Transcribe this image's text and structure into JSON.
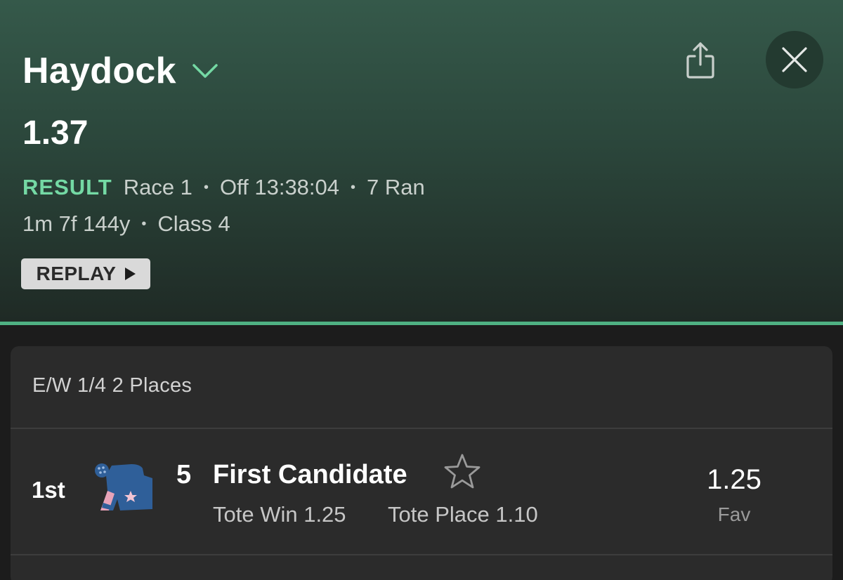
{
  "header": {
    "venue": "Haydock",
    "race_time": "1.37",
    "status": "RESULT",
    "race_number": "Race 1",
    "off_time": "Off 13:38:04",
    "runners": "7 Ran",
    "distance": "1m 7f 144y",
    "race_class": "Class 4",
    "replay_label": "REPLAY",
    "icons": {
      "venue_dropdown": "chevron-down-icon",
      "share": "share-icon",
      "close": "close-icon",
      "play": "play-icon"
    },
    "colors": {
      "status": "#74d9a4",
      "accent": "#4fb183"
    }
  },
  "result_card": {
    "terms": "E/W 1/4 2 Places",
    "rows": [
      {
        "position": "1st",
        "number": "5",
        "horse": "First Candidate",
        "tote_win": "Tote Win 1.25",
        "tote_place": "Tote Place 1.10",
        "odds": "1.25",
        "odds_note": "Fav",
        "silks_colors": [
          "#2f5f99",
          "#e8a3b8"
        ],
        "star_icon": "star-outline-icon"
      }
    ]
  }
}
